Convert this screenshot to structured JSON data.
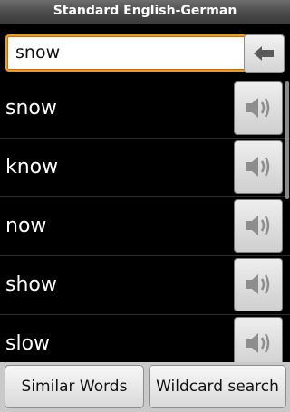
{
  "app": {
    "title": "Standard English-German"
  },
  "search": {
    "value": "snow"
  },
  "back_button": {
    "icon": "backspace-arrow-icon"
  },
  "results": [
    {
      "word": "snow",
      "icon": "speaker-icon"
    },
    {
      "word": "know",
      "icon": "speaker-icon"
    },
    {
      "word": "now",
      "icon": "speaker-icon"
    },
    {
      "word": "show",
      "icon": "speaker-icon"
    },
    {
      "word": "slow",
      "icon": "speaker-icon"
    }
  ],
  "bottom": {
    "similar_words_label": "Similar Words",
    "wildcard_search_label": "Wildcard search"
  },
  "colors": {
    "accent": "#f19a1e",
    "background": "#000000"
  }
}
